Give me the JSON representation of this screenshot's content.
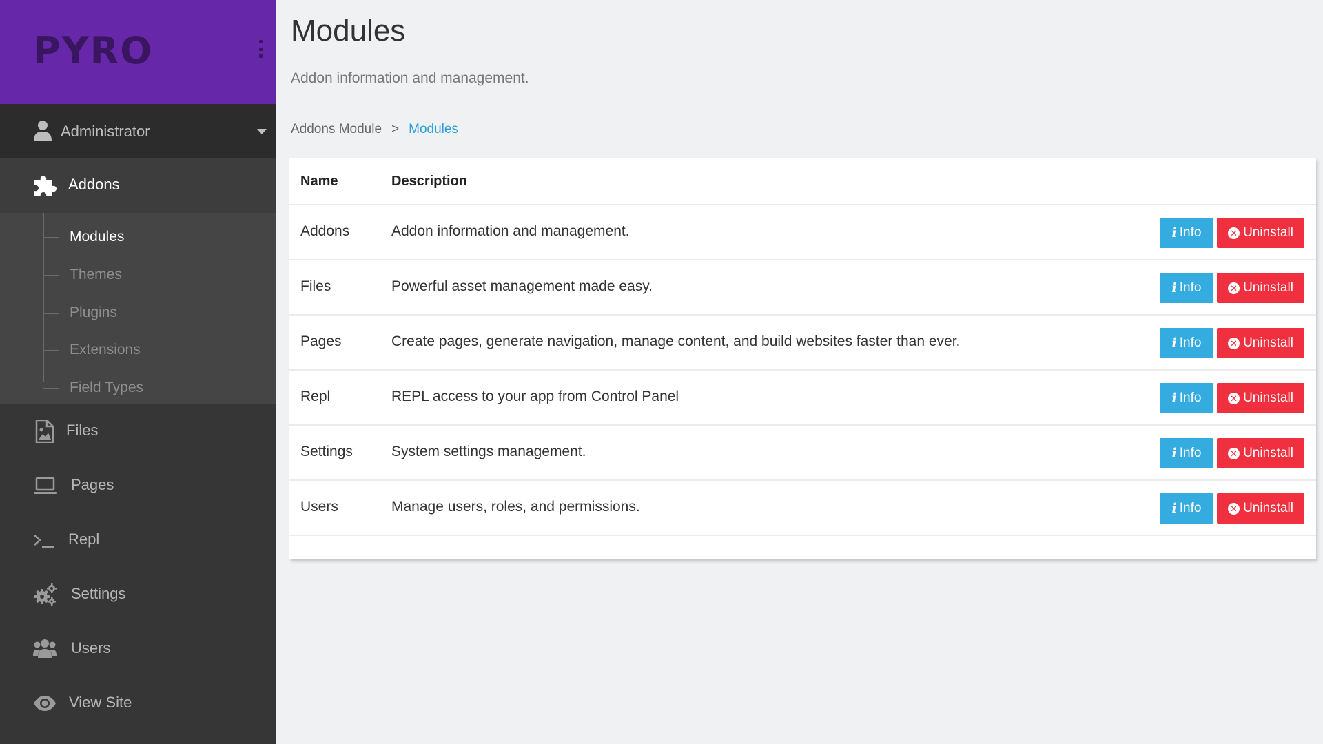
{
  "brand": {
    "logo_text": "PYRO"
  },
  "user": {
    "label": "Administrator"
  },
  "nav": {
    "addons": {
      "label": "Addons"
    },
    "sub_items": [
      {
        "label": "Modules",
        "active": true
      },
      {
        "label": "Themes",
        "active": false
      },
      {
        "label": "Plugins",
        "active": false
      },
      {
        "label": "Extensions",
        "active": false
      },
      {
        "label": "Field Types",
        "active": false
      }
    ],
    "items": [
      {
        "label": "Files",
        "icon": "file-image-icon"
      },
      {
        "label": "Pages",
        "icon": "laptop-icon"
      },
      {
        "label": "Repl",
        "icon": "terminal-icon"
      },
      {
        "label": "Settings",
        "icon": "cogs-icon"
      },
      {
        "label": "Users",
        "icon": "users-icon"
      },
      {
        "label": "View Site",
        "icon": "eye-icon"
      }
    ]
  },
  "page": {
    "title": "Modules",
    "subtitle": "Addon information and management.",
    "breadcrumb": {
      "parent": "Addons Module",
      "separator": ">",
      "current": "Modules"
    }
  },
  "table": {
    "headers": {
      "name": "Name",
      "description": "Description"
    },
    "buttons": {
      "info": "Info",
      "uninstall": "Uninstall"
    },
    "rows": [
      {
        "name": "Addons",
        "description": "Addon information and management."
      },
      {
        "name": "Files",
        "description": "Powerful asset management made easy."
      },
      {
        "name": "Pages",
        "description": "Create pages, generate navigation, manage content, and build websites faster than ever."
      },
      {
        "name": "Repl",
        "description": "REPL access to your app from Control Panel"
      },
      {
        "name": "Settings",
        "description": "System settings management."
      },
      {
        "name": "Users",
        "description": "Manage users, roles, and permissions."
      }
    ]
  },
  "colors": {
    "brand_purple": "#6628a8",
    "sidebar_bg": "#363636",
    "info_blue": "#34ace0",
    "danger_red": "#f0303f",
    "link_blue": "#2c9fd6"
  }
}
